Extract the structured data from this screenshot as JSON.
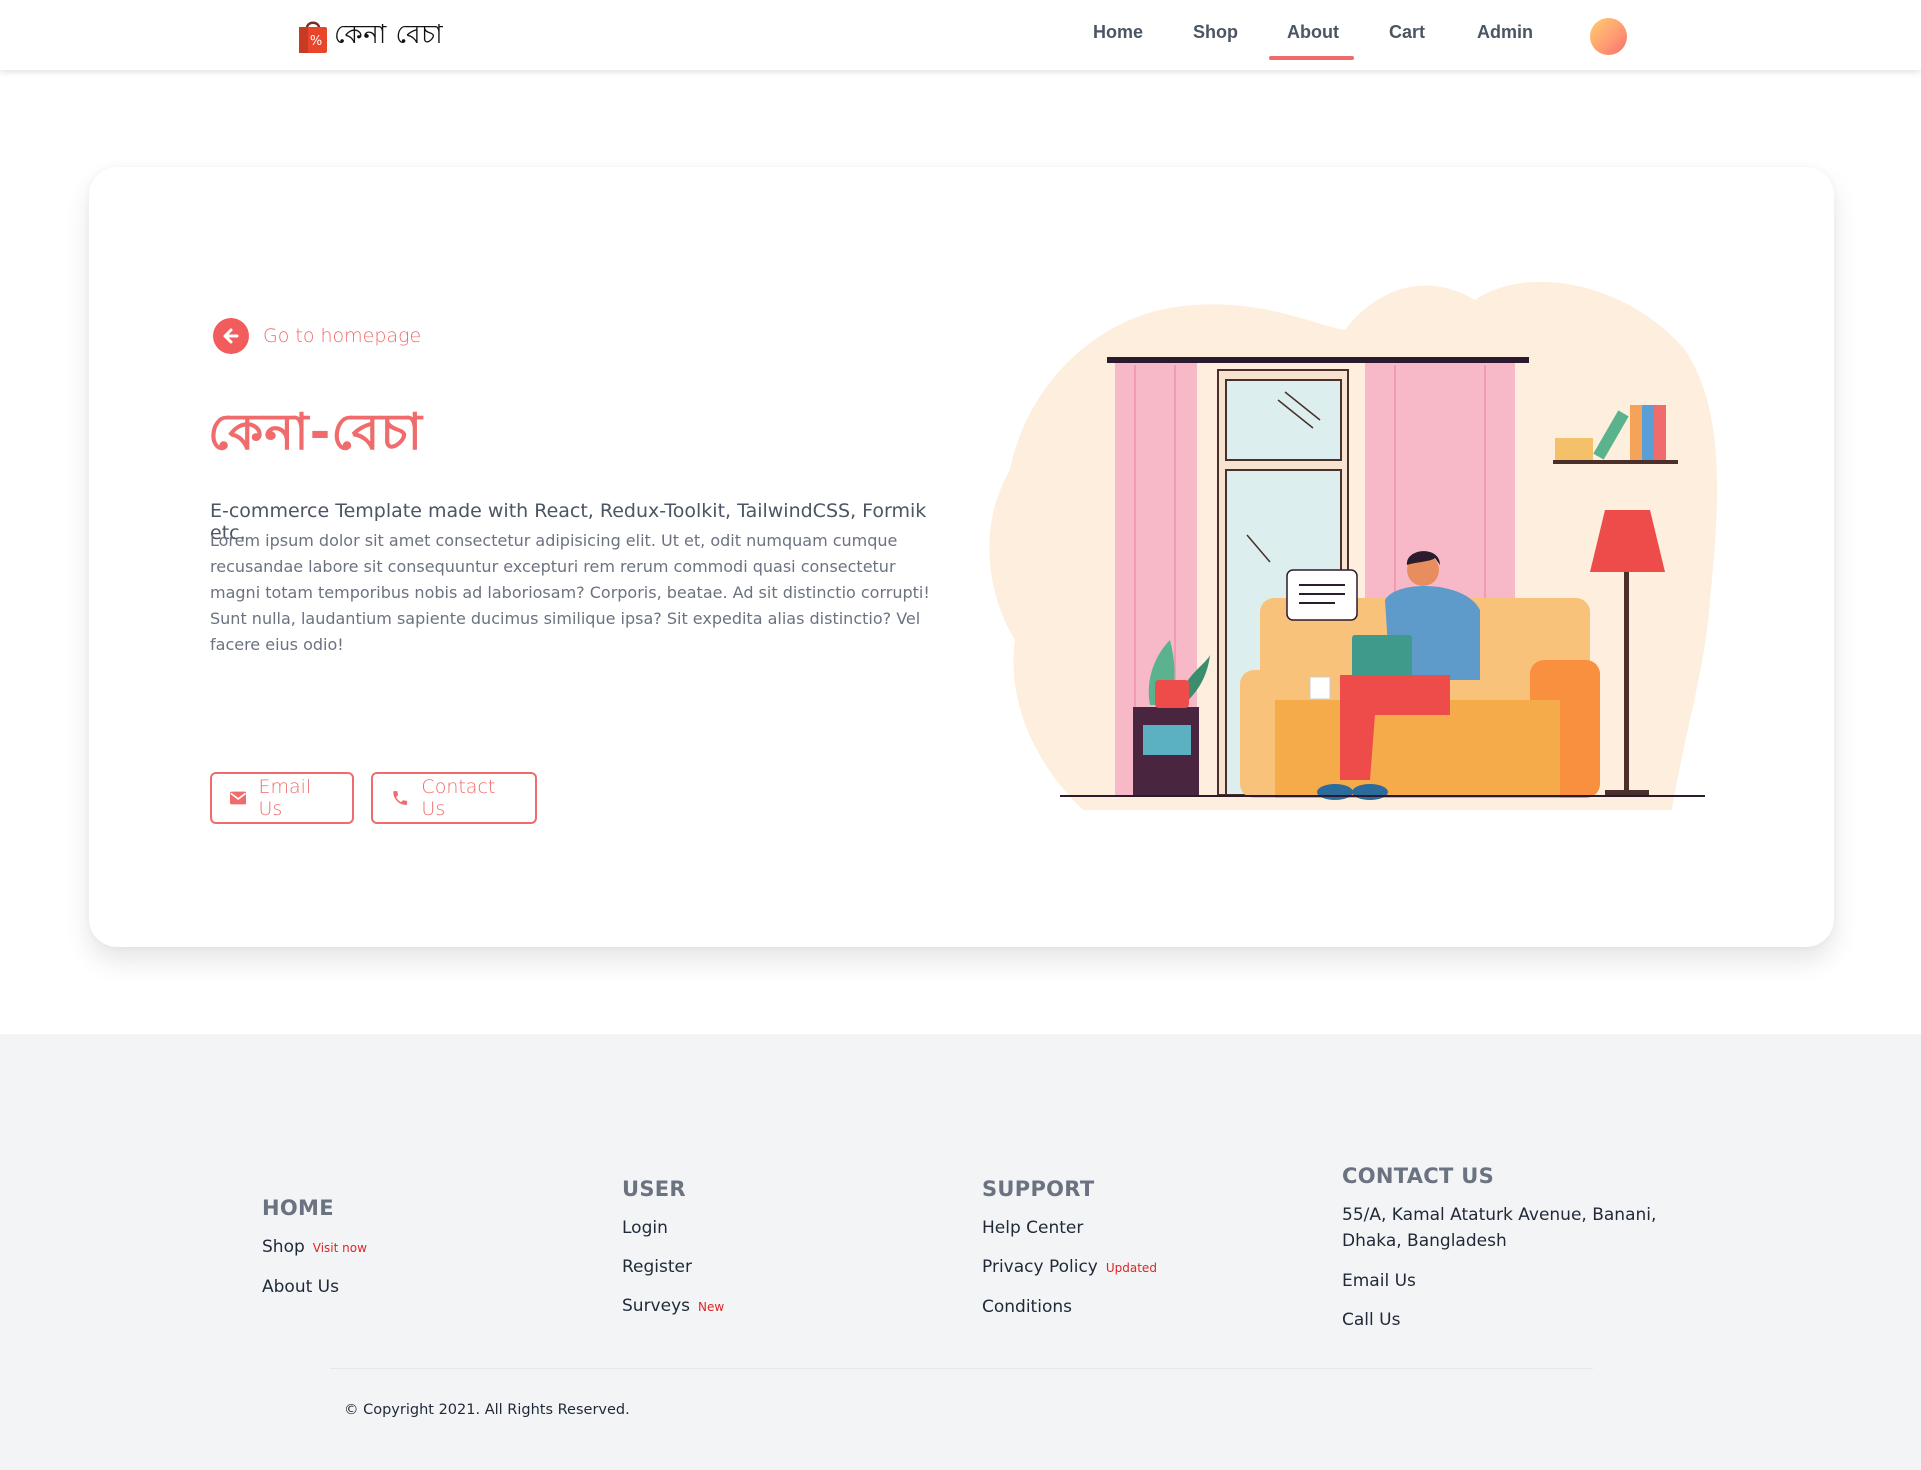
{
  "brand": {
    "name": "কেনা বেচা",
    "icon": "shopping-bag-percent-icon"
  },
  "nav": {
    "items": [
      {
        "label": "Home"
      },
      {
        "label": "Shop"
      },
      {
        "label": "About",
        "active": true
      },
      {
        "label": "Cart"
      },
      {
        "label": "Admin"
      }
    ],
    "avatar_icon": "user-avatar"
  },
  "hero": {
    "back_link": "Go to homepage",
    "back_icon": "arrow-left-circle-icon",
    "title": "কেনা-বেচা",
    "subtitle": "E-commerce Template made with React, Redux-Toolkit, TailwindCSS, Formik etc.",
    "body": "Lorem ipsum dolor sit amet consectetur adipisicing elit. Ut et, odit numquam cumque recusandae labore sit consequuntur excepturi rem rerum commodi quasi consectetur magni totam temporibus nobis ad laboriosam? Corporis, beatae. Ad sit distinctio corrupti! Sunt nulla, laudantium sapiente ducimus similique ipsa? Sit expedita alias distinctio? Vel facere eius odio!",
    "buttons": {
      "email": "Email Us",
      "contact": "Contact Us"
    },
    "illustration": "man-working-on-laptop-on-sofa"
  },
  "footer": {
    "home": {
      "heading": "HOME",
      "shop": "Shop",
      "shop_tag": "Visit now",
      "about": "About Us"
    },
    "user": {
      "heading": "USER",
      "login": "Login",
      "register": "Register",
      "surveys": "Surveys",
      "surveys_tag": "New"
    },
    "support": {
      "heading": "SUPPORT",
      "help": "Help Center",
      "privacy": "Privacy Policy",
      "privacy_tag": "Updated",
      "conditions": "Conditions"
    },
    "contact": {
      "heading": "CONTACT US",
      "address": "55/A, Kamal Ataturk Avenue, Banani, Dhaka, Bangladesh",
      "email": "Email Us",
      "call": "Call Us"
    },
    "copyright": "© Copyright 2021. All Rights Reserved."
  },
  "colors": {
    "accent": "#f06b6b",
    "footer_bg": "#f3f4f6",
    "blob": "#fdeedd"
  }
}
